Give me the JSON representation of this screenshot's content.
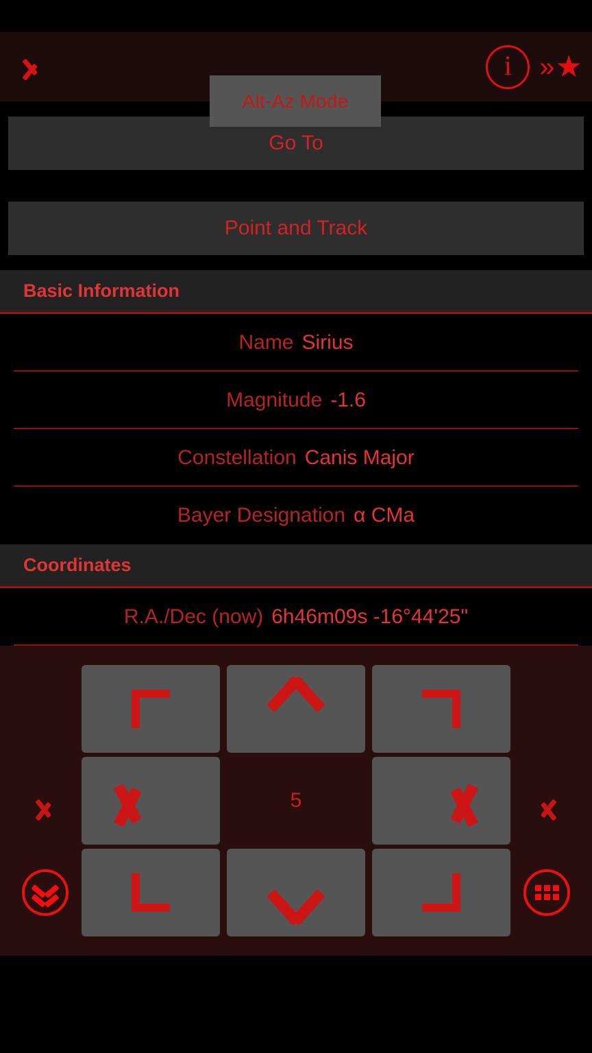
{
  "topbar": {
    "back_icon": "chevron-left-icon",
    "mode_button_label": "Alt-Az Mode",
    "info_icon": "info-icon",
    "info_glyph": "i",
    "double_chevron_glyph": "»",
    "star_glyph": "★"
  },
  "actions": {
    "goto_label": "Go To",
    "point_track_label": "Point and Track"
  },
  "basic_information": {
    "header": "Basic Information",
    "rows": [
      {
        "label": "Name",
        "value": "Sirius"
      },
      {
        "label": "Magnitude",
        "value": "-1.6"
      },
      {
        "label": "Constellation",
        "value": "Canis Major"
      },
      {
        "label": "Bayer Designation",
        "value": "α CMa"
      }
    ]
  },
  "coordinates": {
    "header": "Coordinates",
    "rows": [
      {
        "label": "R.A./Dec (now)",
        "value": "6h46m09s -16°44'25\""
      }
    ]
  },
  "dpad": {
    "speed_value": "5",
    "buttons": [
      {
        "name": "up-left",
        "icon": "corner-top-left-icon"
      },
      {
        "name": "up",
        "icon": "chevron-up-icon"
      },
      {
        "name": "up-right",
        "icon": "corner-top-right-icon"
      },
      {
        "name": "left",
        "icon": "chevron-left-icon"
      },
      {
        "name": "speed",
        "icon": "speed-indicator"
      },
      {
        "name": "right",
        "icon": "chevron-right-icon"
      },
      {
        "name": "down-left",
        "icon": "corner-bottom-left-icon"
      },
      {
        "name": "down",
        "icon": "chevron-down-icon"
      },
      {
        "name": "down-right",
        "icon": "corner-bottom-right-icon"
      }
    ],
    "side_left_icon": "chevron-left-icon",
    "side_right_icon": "chevron-right-icon",
    "collapse_icon": "double-chevron-down-circle-icon",
    "grid_icon": "grid-menu-circle-icon"
  },
  "colors": {
    "accent_red": "#e01010",
    "text_red": "#e43434",
    "label_red": "#b72323",
    "button_gray": "#555555",
    "action_gray": "#2e2e2e",
    "panel_black": "#000000",
    "dpad_maroon": "#2a0e0e",
    "topbar_maroon": "#1e0b0b",
    "section_header_gray": "#222222"
  }
}
